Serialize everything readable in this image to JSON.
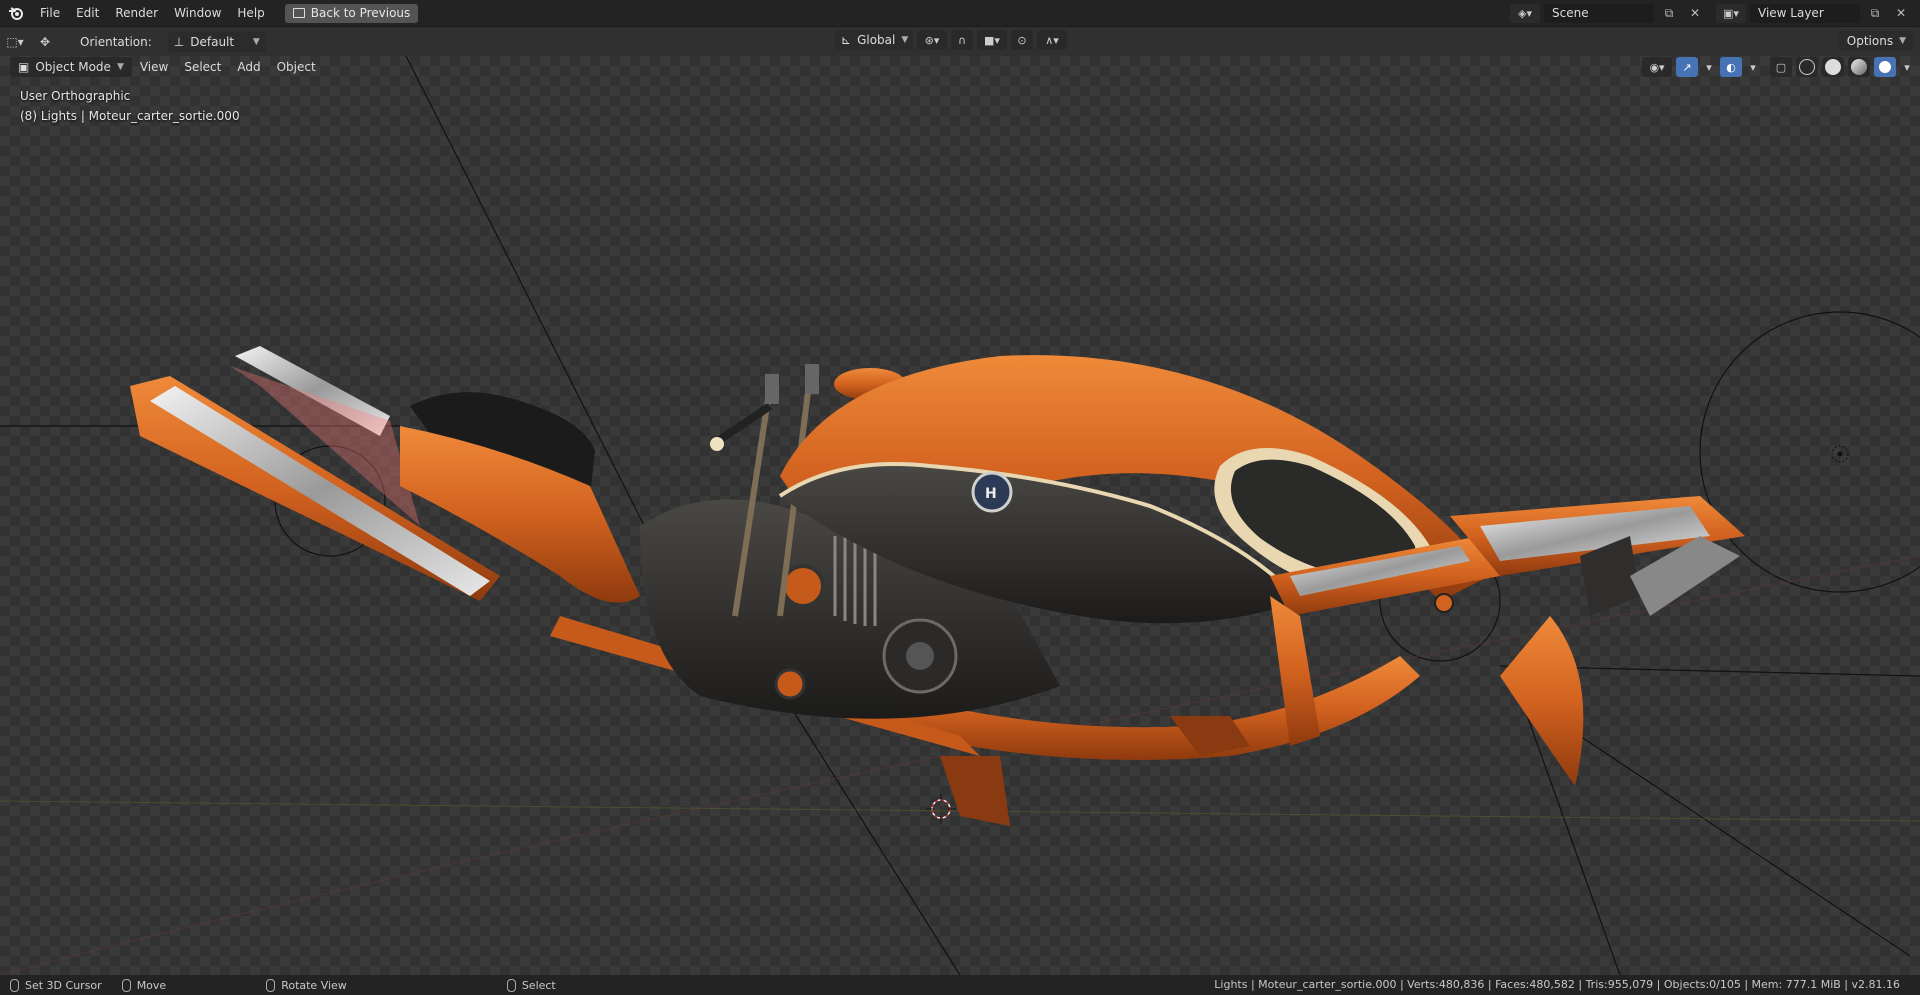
{
  "topbar": {
    "menu": [
      "File",
      "Edit",
      "Render",
      "Window",
      "Help"
    ],
    "back_button": "Back to Previous",
    "scene": "Scene",
    "view_layer": "View Layer"
  },
  "toolheader": {
    "orientation_label": "Orientation:",
    "orientation_value": "Default",
    "transform_orientation": "Global",
    "options_label": "Options"
  },
  "viewport": {
    "mode": "Object Mode",
    "menu": [
      "View",
      "Select",
      "Add",
      "Object"
    ],
    "view_name": "User Orthographic",
    "active_info": "(8) Lights | Moteur_carter_sortie.000"
  },
  "statusbar": {
    "left_action": "Set 3D Cursor",
    "middle_action": "Move",
    "right_action": "Rotate View",
    "select_action": "Select",
    "stats": "Lights | Moteur_carter_sortie.000 | Verts:480,836 | Faces:480,582 | Tris:955,079 | Objects:0/105 | Mem: 777.1 MiB | v2.81.16"
  },
  "colors": {
    "accent": "#4772b3",
    "body_orange": "#d2621f",
    "viewport_bg": "#3a3a3a"
  },
  "icons": [
    "blender-logo-icon",
    "back-icon",
    "scene-icon",
    "view-layer-icon",
    "transform-tool-icon",
    "move-icon",
    "snap-icon",
    "proportional-icon",
    "visibility-icon",
    "gizmo-icon",
    "overlay-icon",
    "xray-icon",
    "wireframe-shading-icon",
    "solid-shading-icon",
    "material-shading-icon",
    "rendered-shading-icon",
    "light-icon",
    "cursor-3d-icon",
    "mouse-left-icon",
    "mouse-middle-icon",
    "mouse-right-icon"
  ]
}
